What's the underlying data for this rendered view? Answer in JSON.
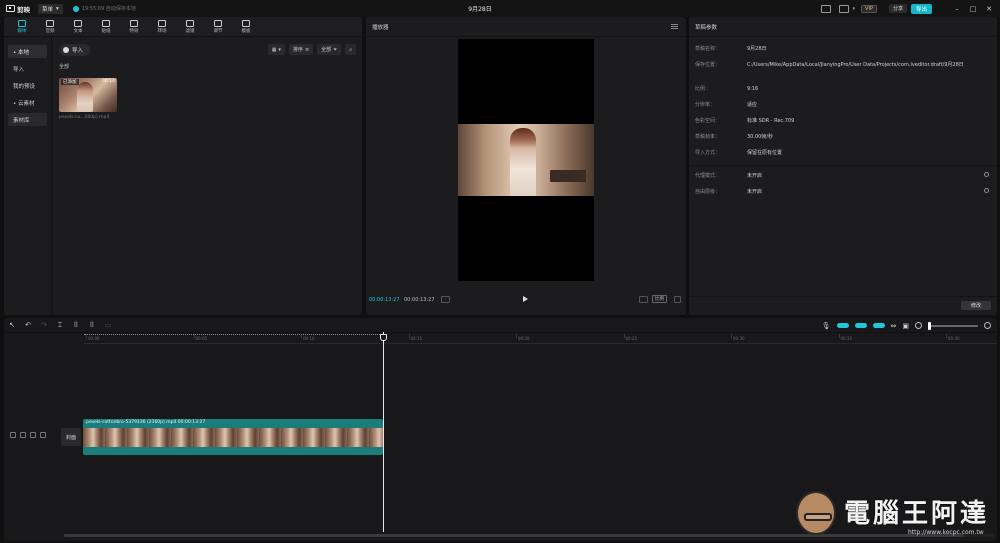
{
  "topbar": {
    "app_name": "剪映",
    "menu_label": "菜单",
    "autosave_text": "19:55:09 自动保存本地",
    "title": "9月28日",
    "vip_label": "VIP",
    "share_label": "分享",
    "export_label": "导出"
  },
  "tools": [
    {
      "label": "媒体",
      "icon": "media-icon"
    },
    {
      "label": "音频",
      "icon": "audio-icon"
    },
    {
      "label": "文本",
      "icon": "text-icon"
    },
    {
      "label": "贴纸",
      "icon": "sticker-icon"
    },
    {
      "label": "特效",
      "icon": "effects-icon"
    },
    {
      "label": "转场",
      "icon": "transition-icon"
    },
    {
      "label": "滤镜",
      "icon": "filter-icon"
    },
    {
      "label": "调节",
      "icon": "adjust-icon"
    },
    {
      "label": "模板",
      "icon": "template-icon"
    }
  ],
  "media_nav": {
    "local": "• 本地",
    "import": "导入",
    "my_presets": "我的预设",
    "cloud": "• 云素材",
    "library": "素材库"
  },
  "media_main": {
    "import_button": "导入",
    "sort_label": "排序",
    "filter_label": "全部",
    "section": "全部",
    "clip_badge": "已添加",
    "clip_duration": "00:14",
    "clip_name": "pexels-co...160p).mp4"
  },
  "player": {
    "title": "播放器",
    "current_time": "00:00:13:27",
    "total_time": "00:00:13:27",
    "ratio_label": "比例"
  },
  "params": {
    "title": "草稿参数",
    "rows": [
      {
        "label": "草稿名称：",
        "value": "9月28日"
      },
      {
        "label": "保存位置：",
        "value": "C:/Users/Mike/AppData/Local/JianyingPro/User Data/Projects/com.lveditor.draft/9月28日"
      },
      {
        "label": "比例：",
        "value": "9:16"
      },
      {
        "label": "分辨率：",
        "value": "适应"
      },
      {
        "label": "色彩空间：",
        "value": "标准 SDR - Rec.709"
      },
      {
        "label": "草稿帧率：",
        "value": "30.00帧/秒"
      },
      {
        "label": "导入方式：",
        "value": "保留在原有位置"
      }
    ],
    "proxy_label": "代理模式：",
    "proxy_value": "未开启",
    "free_layer_label": "自由层级：",
    "free_layer_value": "未开启",
    "modify_button": "修改"
  },
  "timeline": {
    "ticks": [
      "00:00",
      "00:05",
      "00:10",
      "00:15",
      "00:20",
      "00:25",
      "00:30",
      "00:35",
      "00:40"
    ],
    "cover_label": "封面",
    "clip_label": "pexels-cottonbro-5379136 (2160p).mp4   00:00:13:27"
  },
  "watermark": {
    "text": "電腦王阿達",
    "url": "http://www.kocpc.com.tw"
  },
  "colors": {
    "accent": "#22c6d8",
    "clip": "#1a7d7c"
  }
}
